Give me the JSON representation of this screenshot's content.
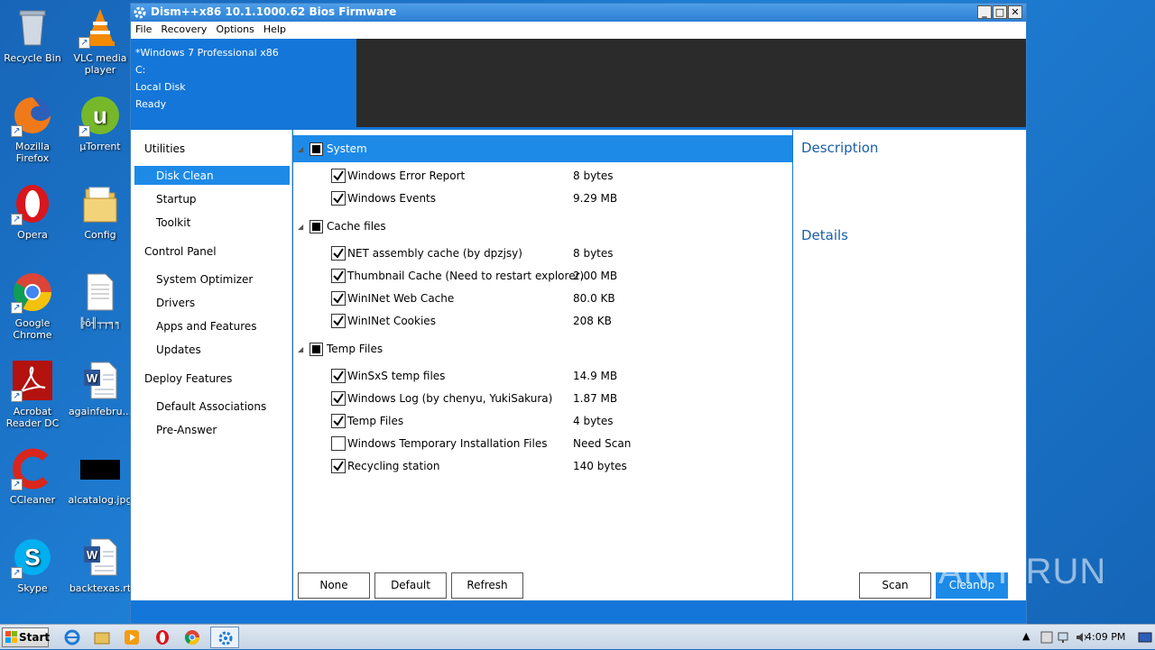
{
  "desktop": {
    "icons": [
      {
        "label": "Recycle Bin",
        "icon": "recycle-bin-icon"
      },
      {
        "label": "VLC media player",
        "icon": "vlc-icon"
      },
      {
        "label": "Mozilla Firefox",
        "icon": "firefox-icon"
      },
      {
        "label": "µTorrent",
        "icon": "utorrent-icon"
      },
      {
        "label": "Opera",
        "icon": "opera-icon"
      },
      {
        "label": "Config",
        "icon": "folder-icon"
      },
      {
        "label": "Google Chrome",
        "icon": "chrome-icon"
      },
      {
        "label": "╠ô╢┬┬╕╕",
        "icon": "text-file-icon"
      },
      {
        "label": "Acrobat Reader DC",
        "icon": "acrobat-icon"
      },
      {
        "label": "againfebru...",
        "icon": "word-doc-icon"
      },
      {
        "label": "CCleaner",
        "icon": "ccleaner-icon"
      },
      {
        "label": "alcatalog.jpg",
        "icon": "image-file-icon"
      },
      {
        "label": "Skype",
        "icon": "skype-icon"
      },
      {
        "label": "backtexas.rt",
        "icon": "word-doc-icon"
      }
    ]
  },
  "window": {
    "title": "Dism++x86 10.1.1000.62 Bios Firmware",
    "controls": {
      "minimize": "_",
      "maximize": "□",
      "close": "✕"
    },
    "menu": [
      "File",
      "Recovery",
      "Options",
      "Help"
    ],
    "banner": {
      "os": "*Windows 7 Professional x86",
      "drive": "C:",
      "disk": "Local Disk",
      "status": "Ready"
    }
  },
  "sidebar": {
    "utilities": "Utilities",
    "utilities_items": [
      "Disk Clean",
      "Startup",
      "Toolkit"
    ],
    "control_panel": "Control Panel",
    "control_panel_items": [
      "System Optimizer",
      "Drivers",
      "Apps and Features",
      "Updates"
    ],
    "deploy": "Deploy Features",
    "deploy_items": [
      "Default Associations",
      "Pre-Answer"
    ],
    "selected": "Disk Clean"
  },
  "main": {
    "groups": [
      {
        "label": "System",
        "selected": true,
        "items": [
          {
            "label": "Windows Error Report",
            "size": "8 bytes",
            "checked": true
          },
          {
            "label": "Windows Events",
            "size": "9.29 MB",
            "checked": true
          }
        ]
      },
      {
        "label": "Cache files",
        "selected": false,
        "items": [
          {
            "label": "NET assembly cache (by dpzjsy)",
            "size": "8 bytes",
            "checked": true
          },
          {
            "label": "Thumbnail Cache (Need to restart explorer)",
            "size": "2.00 MB",
            "checked": true
          },
          {
            "label": "WinINet Web Cache",
            "size": "80.0 KB",
            "checked": true
          },
          {
            "label": "WinINet Cookies",
            "size": "208 KB",
            "checked": true
          }
        ]
      },
      {
        "label": "Temp Files",
        "selected": false,
        "items": [
          {
            "label": "WinSxS temp files",
            "size": "14.9 MB",
            "checked": true
          },
          {
            "label": "Windows Log (by chenyu, YukiSakura)",
            "size": "1.87 MB",
            "checked": true
          },
          {
            "label": "Temp Files",
            "size": "4 bytes",
            "checked": true
          },
          {
            "label": "Windows Temporary Installation Files",
            "size": "Need Scan",
            "checked": false
          },
          {
            "label": "Recycling station",
            "size": "140 bytes",
            "checked": true
          }
        ]
      }
    ],
    "buttons": {
      "none": "None",
      "default": "Default",
      "refresh": "Refresh",
      "scan": "Scan",
      "cleanup": "CleanUp"
    }
  },
  "description": {
    "title": "Description",
    "details": "Details"
  },
  "taskbar": {
    "start": "Start",
    "clock": "4:09 PM"
  },
  "watermark": "ANY RUN",
  "colors": {
    "accent": "#1d8ae8",
    "desktop": "#1a6fc4"
  }
}
